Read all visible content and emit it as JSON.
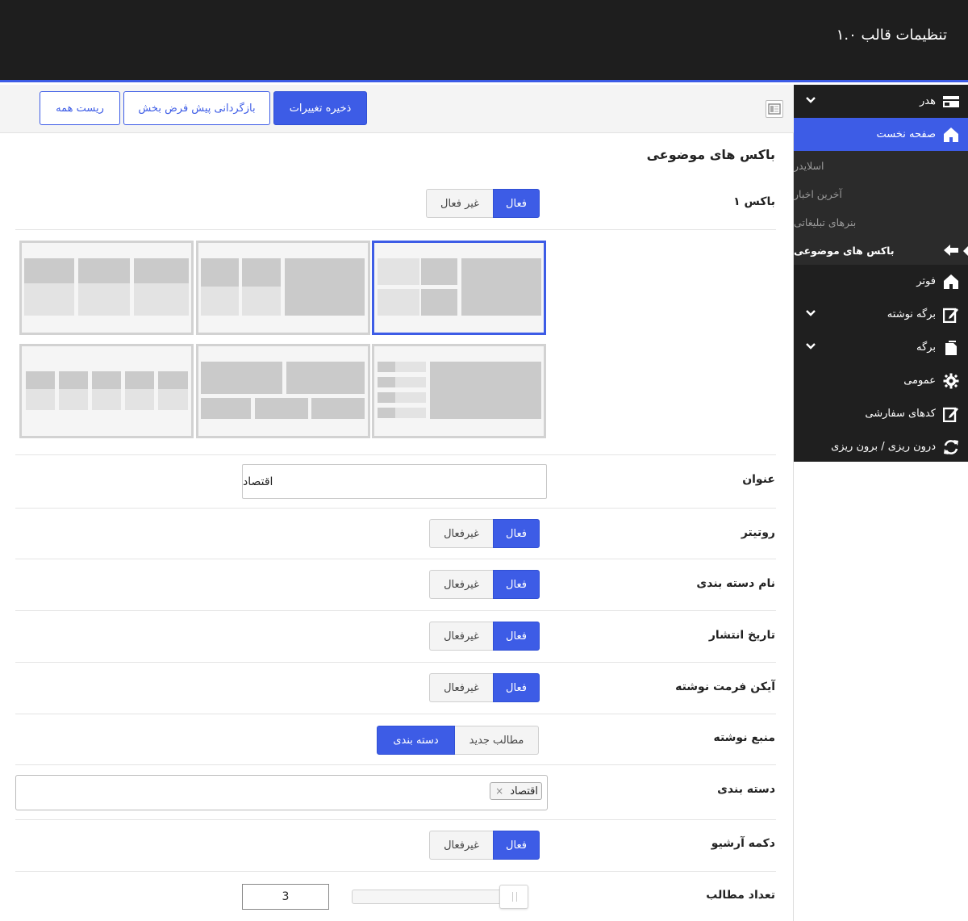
{
  "header": {
    "title": "تنظیمات قالب ۱.۰"
  },
  "toolbar": {
    "save_label": "ذخیره تغییرات",
    "restore_label": "بازگردانی پیش فرض بخش",
    "reset_label": "ریست همه"
  },
  "sidebar": {
    "items": [
      {
        "label": "هدر",
        "icon": "header-icon",
        "has_arrow": true
      },
      {
        "label": "صفحه نخست",
        "icon": "home-icon",
        "active": true
      },
      {
        "label": "فوتر",
        "icon": "home-icon"
      },
      {
        "label": "برگه نوشته",
        "icon": "edit-icon",
        "has_arrow": true
      },
      {
        "label": "برگه",
        "icon": "page-icon",
        "has_arrow": true
      },
      {
        "label": "عمومی",
        "icon": "gear-icon"
      },
      {
        "label": "کدهای سفارشی",
        "icon": "code-edit-icon"
      },
      {
        "label": "درون ریزی / برون ریزی",
        "icon": "refresh-icon"
      }
    ],
    "submenu": [
      {
        "label": "اسلایدر"
      },
      {
        "label": "آخرین اخبار"
      },
      {
        "label": "بنرهای تبلیغاتی"
      },
      {
        "label": "باکس های موضوعی",
        "current": true
      }
    ]
  },
  "main": {
    "section_title": "باکس های موضوعی",
    "box1": {
      "label": "باکس ۱",
      "on": "فعال",
      "off": "غیر فعال",
      "selected": "on"
    },
    "layout_selected_index": 0,
    "title_field": {
      "label": "عنوان",
      "value": "اقتصاد"
    },
    "rows": [
      {
        "label": "روتیتر",
        "on": "فعال",
        "off": "غیرفعال",
        "selected": "on"
      },
      {
        "label": "نام دسته بندی",
        "on": "فعال",
        "off": "غیرفعال",
        "selected": "on"
      },
      {
        "label": "تاریخ انتشار",
        "on": "فعال",
        "off": "غیرفعال",
        "selected": "on"
      },
      {
        "label": "آیکن فرمت نوشته",
        "on": "فعال",
        "off": "غیرفعال",
        "selected": "on"
      }
    ],
    "source": {
      "label": "منبع نوشته",
      "option_a": "مطالب جدید",
      "option_b": "دسته بندی",
      "selected": "option_b"
    },
    "category": {
      "label": "دسته بندی",
      "tag": "اقتصاد",
      "remove": "×"
    },
    "archive": {
      "label": "دکمه آرشیو",
      "on": "فعال",
      "off": "غیرفعال",
      "selected": "on"
    },
    "post_count": {
      "label": "تعداد مطالب",
      "value": "3"
    }
  },
  "colors": {
    "accent": "#3d5ce6",
    "header_bg": "#1e1e1e",
    "sidebar_bg": "#1f1f1f",
    "submenu_bg": "#2b2b2b"
  }
}
